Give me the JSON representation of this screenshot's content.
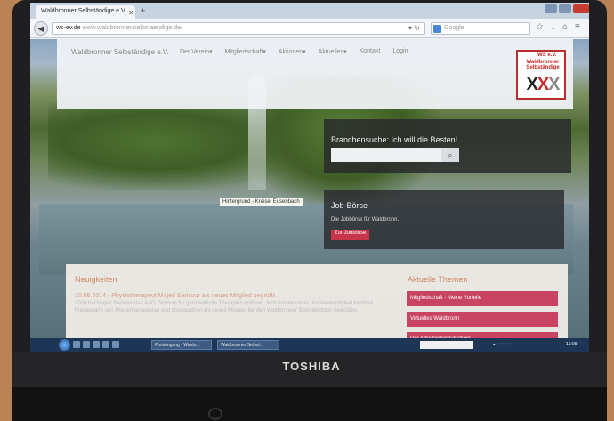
{
  "laptop": {
    "brand": "TOSHIBA"
  },
  "browser": {
    "tab_title": "Waldbronner Selbständige e.V.",
    "url_domain": "ws-ev.de",
    "url_path": "www.waldbronner-selbstaendige.de/",
    "search_placeholder": "Google"
  },
  "site": {
    "name": "Waldbronner Selbständige e.V.",
    "menu": [
      "Der Verein▾",
      "Mitgliedschaft▾",
      "Aktionen▾",
      "Aktuelles▾",
      "Kontakt",
      "Login"
    ],
    "logo": {
      "tag": "WS e.V.",
      "title_1": "Waldbronner",
      "title_2": "Selbständige"
    }
  },
  "search": {
    "title": "Branchensuche: Ich will die Besten!",
    "value": ""
  },
  "tooltip": "Hintergrund - Kreisel Eusenbach",
  "job": {
    "title": "Job-Börse",
    "description": "Die Jobbörse für Waldbronn.",
    "button": "Zur Jobbörse"
  },
  "news": {
    "title": "Neuigkeiten",
    "headline": "10.05.2014 - Physiotherapeut Majed Sarisour als neues Mitglied begrüßt",
    "text": "2009 hat Majed Sarisour das A&O Zentrum für ganzheitliche Therapien eröffnet. Jetzt konnte unser Vorstandsmitglied Hartmut Friedemann den Physiotherapeuten und Osteopathen als neues Mitglied bei den Waldbronner Selbständigen begrüßen."
  },
  "topics": {
    "title": "Aktuelle Themen",
    "items": [
      "Mitgliedschaft - Meine Vorteile",
      "Virtuelles Waldbronn",
      "Der Arbeitgebergutschein"
    ]
  },
  "taskbar": {
    "tasks": [
      "Posteingang - Windo...",
      "Waldbronner Selbst..."
    ],
    "clock": "13:09"
  },
  "colors": {
    "accent": "#c94462",
    "heading": "#d0876a",
    "dark_box": "#28282c"
  }
}
